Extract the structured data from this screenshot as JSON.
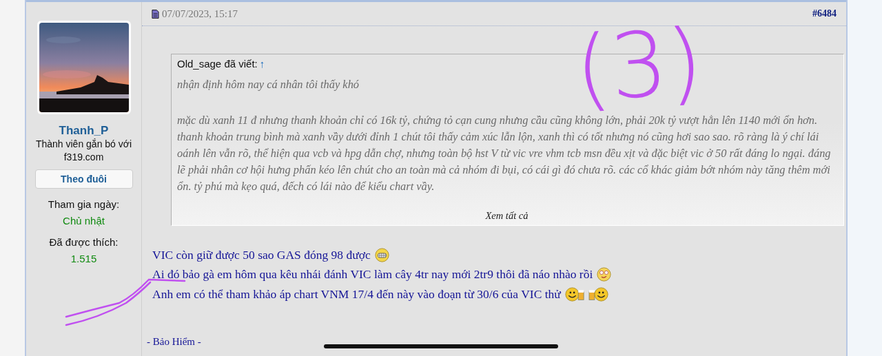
{
  "author": {
    "username": "Thanh_P",
    "rank": "Thành viên gắn bó với f319.com",
    "follow_button": "Theo đuôi",
    "joined_label": "Tham gia ngày:",
    "joined_value": "Chủ nhật",
    "likes_label": "Đã được thích:",
    "likes_value": "1.515"
  },
  "post": {
    "date": "07/07/2023, 15:17",
    "number": "#6484",
    "quote": {
      "header": "Old_sage đã viết:",
      "jump": "↑",
      "paragraphs": [
        "nhận định hôm nay cá nhân tôi thấy khó",
        "mặc dù xanh 11 đ nhưng thanh khoản chỉ có 16k tỷ, chứng tỏ cạn cung nhưng cầu cũng không lớn, phải 20k tỷ vượt hẳn lên 1140 mới ổn hơn. thanh khoản trung bình mà xanh vầy dưới đỉnh 1 chút tôi thấy cảm xúc lẫn lộn, xanh thì có tốt nhưng nó cũng hơi sao sao. rõ ràng là ý chí lái oánh lên vẫn rõ, thể hiện qua vcb và hpg dẫn chợ, nhưng toàn bộ hst V từ vic vre vhm tcb msn đều xịt và đặc biệt vic ở 50 rất đáng lo ngại. đáng lẽ phải nhân cơ hội hưng phấn kéo lên chút cho an toàn mà cả nhóm đi bụi, có cái gì đó chưa rõ. các cổ khác giảm bớt nhóm này tăng thêm mới ổn. tỷ phú mà kẹo quá, đếch có lái nào để kiểu chart vầy."
      ],
      "expand": "Xem tất cả"
    },
    "lines": [
      {
        "text": "VIC còn giữ được 50 sao GAS đóng 98 được",
        "kind": "grin"
      },
      {
        "text": "Ai đó bảo gà em hôm qua kêu nhái đánh VIC làm cây 4tr nay mới 2tr9 thôi đã náo nhào rồi",
        "kind": "dizzy"
      },
      {
        "text": "Anh em có thể tham khảo áp chart VNM 17/4 đến này vào đoạn từ 30/6 của VIC thử",
        "kind": "cheers"
      }
    ],
    "signature": "- Bảo Hiểm -"
  },
  "annotation": {
    "text": "(3)"
  }
}
